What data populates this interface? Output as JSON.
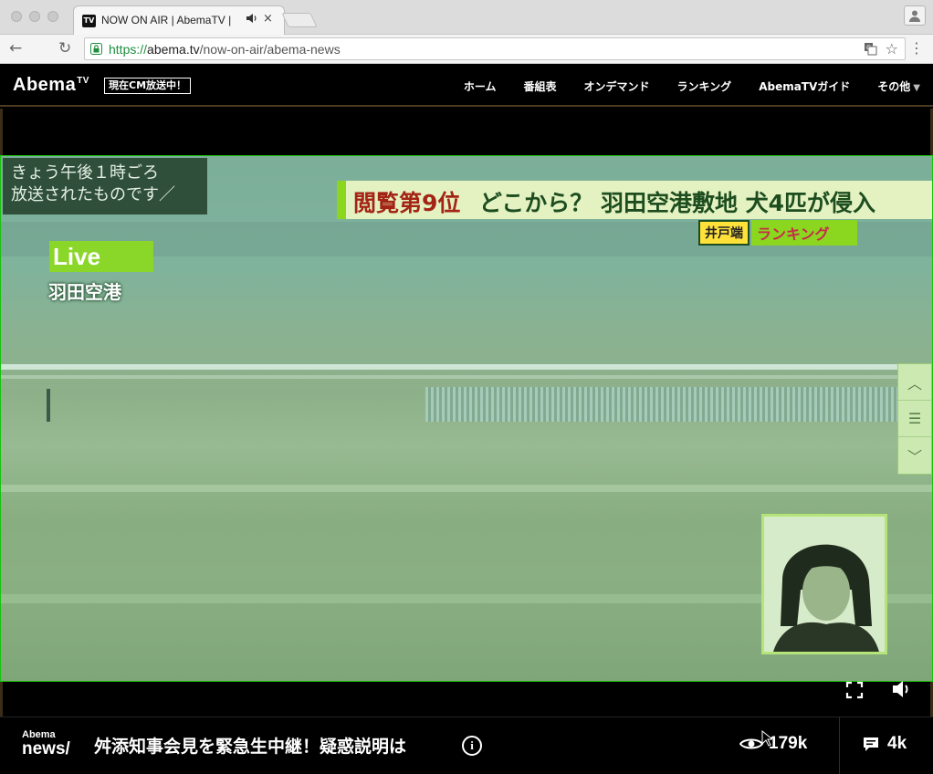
{
  "browser": {
    "tab_title": "NOW ON AIR | AbemaTV | ",
    "tab_favicon_text": "TV",
    "tab_audio_icon": "speaker-icon",
    "tab_close": "×",
    "url_scheme": "https://",
    "url_host": "abema.tv",
    "url_path": "/now-on-air/abema-news",
    "back": "←",
    "reload": "↻",
    "translate_icon": "translate-icon",
    "bookmark_star": "☆",
    "menu": "⋮"
  },
  "header": {
    "logo": "Abema",
    "logo_sup": "TV",
    "cm_badge": "現在CM放送中！",
    "nav": [
      "ホーム",
      "番組表",
      "オンデマンド",
      "ランキング",
      "AbemaTVガイド",
      "その他"
    ],
    "more_caret": "▼"
  },
  "video": {
    "caption_line1": "きょう午後１時ごろ",
    "caption_line2": "放送されたものです／",
    "headline_rank": "閲覧第9位",
    "headline_text": "どこから？ 羽田空港敷地 犬4匹が侵入",
    "ranking_host": "井戸端",
    "ranking_label": "ランキング",
    "live_label": "Live",
    "location": "羽田空港",
    "side_controls": [
      "︿",
      "☰",
      "﹀"
    ],
    "colors": {
      "accent_green": "#8ad629",
      "headline_red": "#a32415",
      "headline_green": "#1d4d1f",
      "frame_green": "#17c20d"
    }
  },
  "info_bar": {
    "channel_logo_top": "Abema",
    "channel_logo_bottom": "news/",
    "program_title": "舛添知事会見を緊急生中継！疑惑説明は",
    "info_icon": "i",
    "viewer_count": "179k",
    "comment_count": "4k"
  }
}
